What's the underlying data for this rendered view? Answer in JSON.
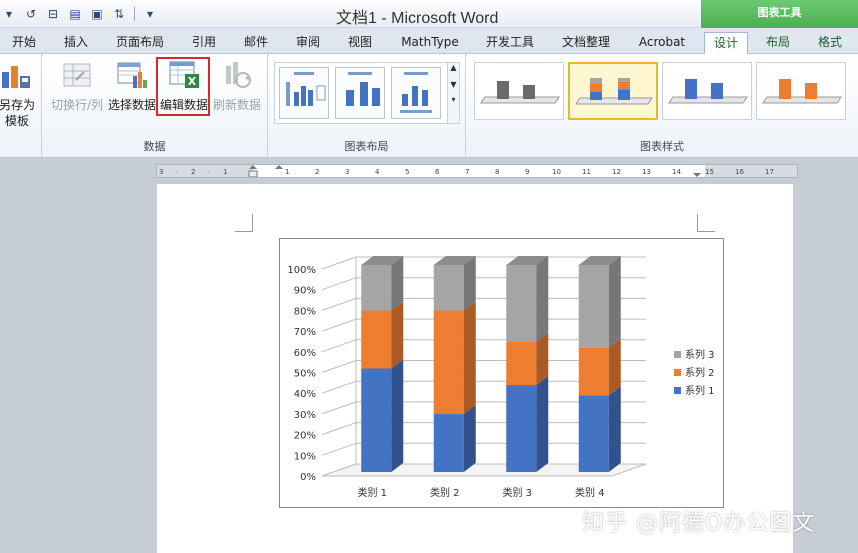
{
  "window": {
    "title": "文档1 - Microsoft Word",
    "context_tab_header": "图表工具"
  },
  "tabs": [
    {
      "label": "开始"
    },
    {
      "label": "插入"
    },
    {
      "label": "页面布局"
    },
    {
      "label": "引用"
    },
    {
      "label": "邮件"
    },
    {
      "label": "审阅"
    },
    {
      "label": "视图"
    },
    {
      "label": "MathType"
    },
    {
      "label": "开发工具"
    },
    {
      "label": "文档整理"
    },
    {
      "label": "Acrobat"
    },
    {
      "label": "设计",
      "active": true
    },
    {
      "label": "布局"
    },
    {
      "label": "格式"
    }
  ],
  "ribbon": {
    "type_group": {
      "save_template_label_1": "另存为",
      "save_template_label_2": "模板"
    },
    "data_group": {
      "label": "数据",
      "switch_row_col": "切换行/列",
      "select_data": "选择数据",
      "edit_data": "编辑数据",
      "refresh_data": "刷新数据"
    },
    "layout_group": {
      "label": "图表布局"
    },
    "styles_group": {
      "label": "图表样式"
    }
  },
  "colors": {
    "series1": "#4472c4",
    "series2": "#ed7d31",
    "series3": "#a5a5a5",
    "highlight": "#d42a2a",
    "context_tab": "#4caf50"
  },
  "chart_data": {
    "type": "bar",
    "stacked": "percent",
    "three_d": true,
    "categories": [
      "类别 1",
      "类别 2",
      "类别 3",
      "类别 4"
    ],
    "series": [
      {
        "name": "系列 1",
        "values": [
          50,
          28,
          42,
          37
        ]
      },
      {
        "name": "系列 2",
        "values": [
          28,
          50,
          21,
          23
        ]
      },
      {
        "name": "系列 3",
        "values": [
          22,
          22,
          37,
          40
        ]
      }
    ],
    "y_ticks": [
      "0%",
      "10%",
      "20%",
      "30%",
      "40%",
      "50%",
      "60%",
      "70%",
      "80%",
      "90%",
      "100%"
    ],
    "ylim": [
      0,
      100
    ],
    "grid": true,
    "legend": "right"
  },
  "watermark": "知乎 @阿德O办公图文"
}
